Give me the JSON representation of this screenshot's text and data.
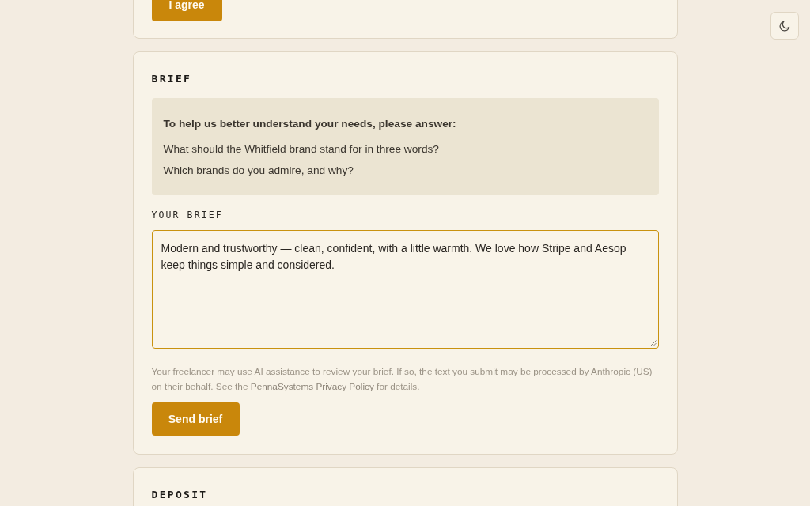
{
  "consent": {
    "agree_button": "I agree"
  },
  "brief": {
    "title": "BRIEF",
    "questions": {
      "intro": "To help us better understand your needs, please answer:",
      "items": [
        "What should the Whitfield brand stand for in three words?",
        "Which brands do you admire, and why?"
      ]
    },
    "field_label": "YOUR BRIEF",
    "value": "Modern and trustworthy — clean, confident, with a little warmth. We love how Stripe and Aesop keep things simple and considered.",
    "focused": true,
    "notice": {
      "before": "Your freelancer may use AI assistance to review your brief. If so, the text you submit may be processed by Anthropic (US) on their behalf. See the ",
      "link": "PennaSystems Privacy Policy",
      "after": " for details."
    },
    "send_button": "Send brief"
  },
  "deposit": {
    "title": "DEPOSIT"
  }
}
